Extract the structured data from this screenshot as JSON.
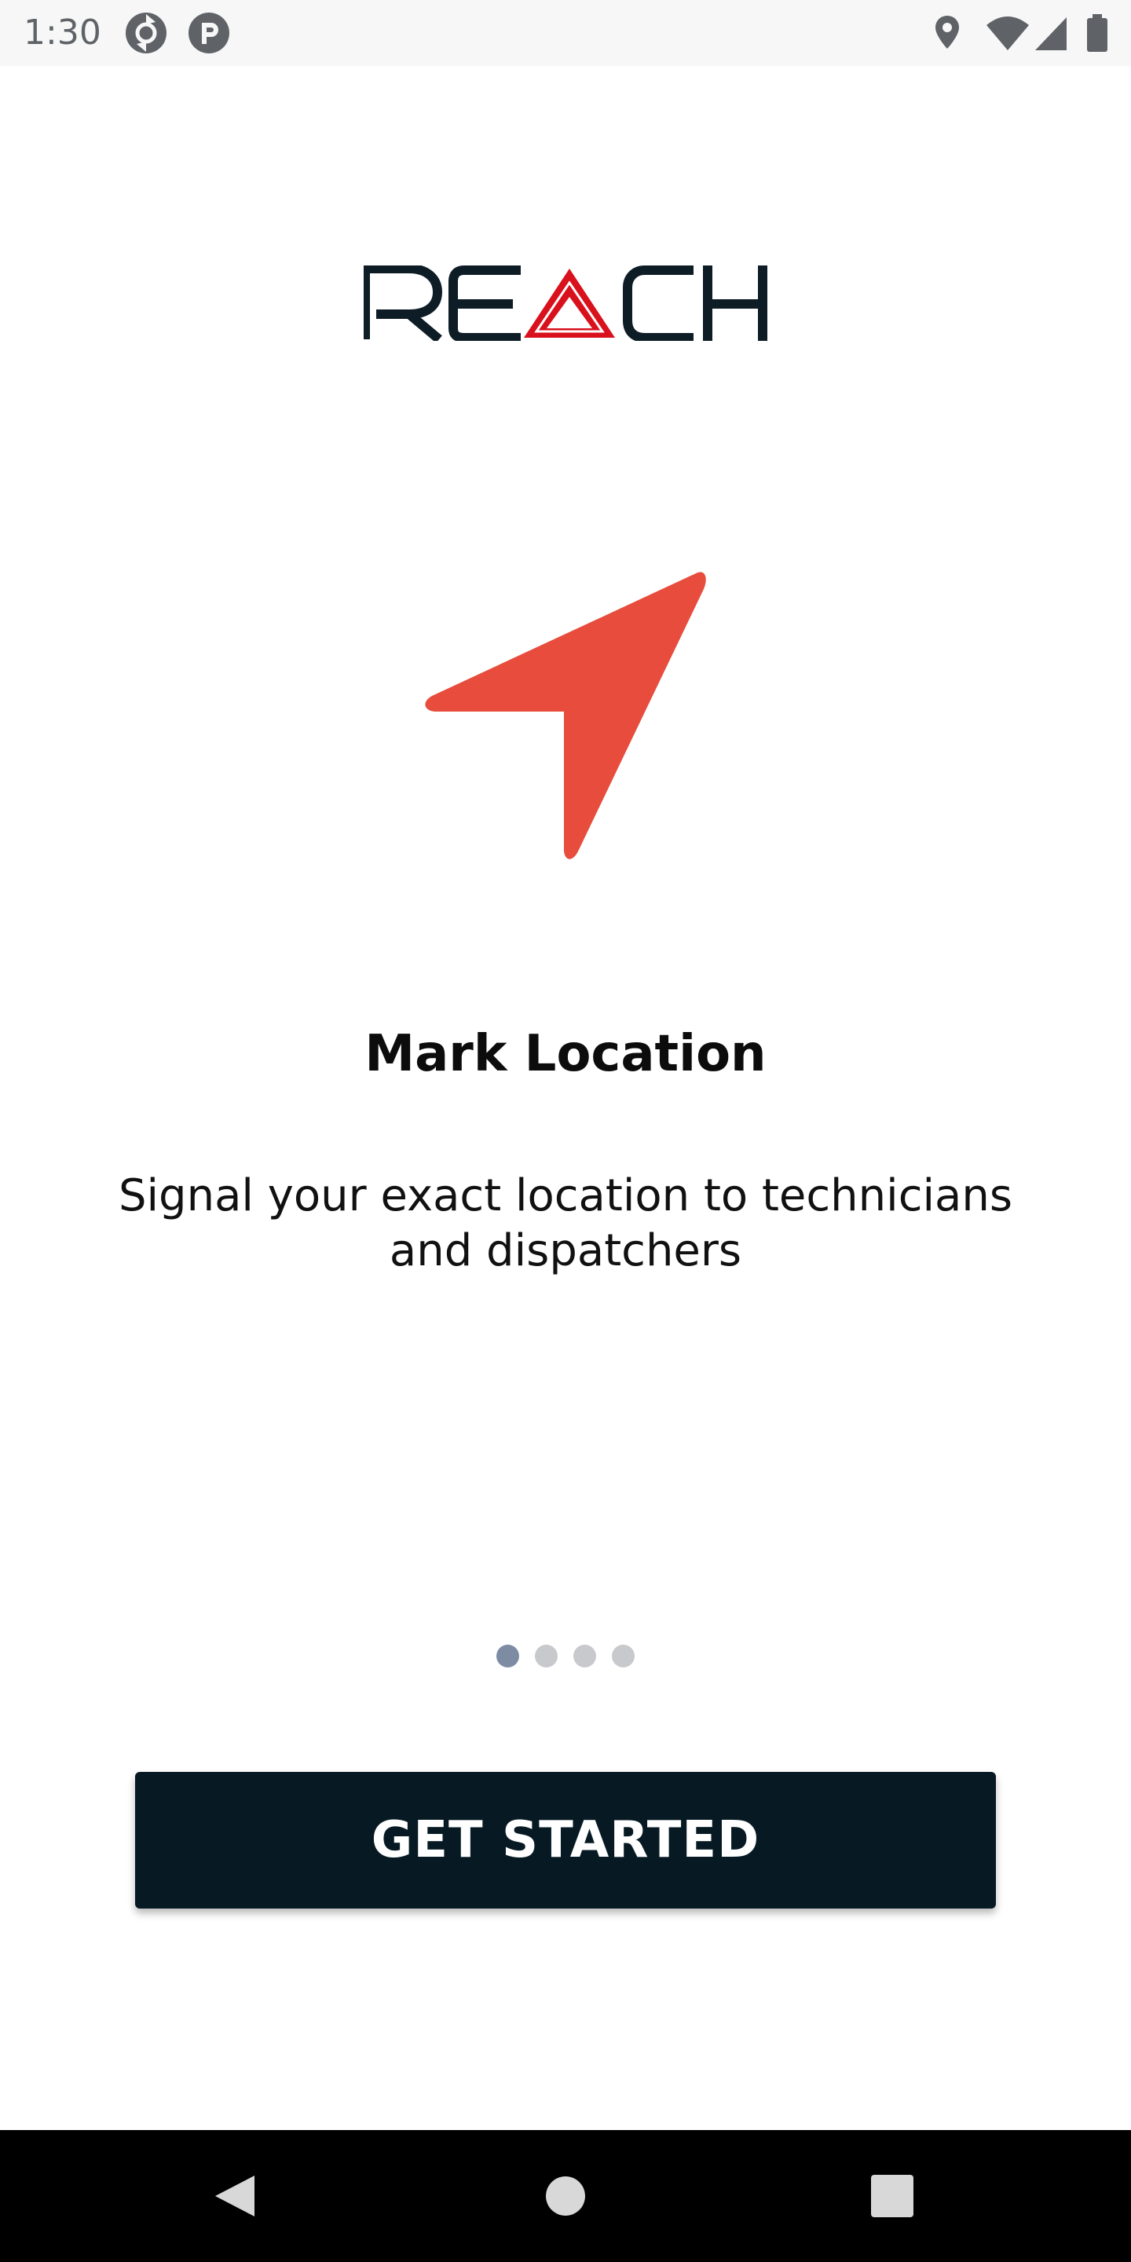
{
  "status_bar": {
    "time": "1:30",
    "left_icons": [
      "sync-app-icon",
      "r-app-icon"
    ],
    "right_icons": [
      "location-icon",
      "wifi-icon",
      "cell-signal-icon",
      "battery-icon"
    ]
  },
  "logo": {
    "text": "REACH",
    "colors": {
      "dark": "#0e1c26",
      "accent": "#d8111c"
    }
  },
  "slide": {
    "icon": "navigation-arrow-icon",
    "icon_color": "#e74c3c",
    "title": "Mark Location",
    "description": "Signal your exact location to technicians and dispatchers"
  },
  "pager": {
    "total": 4,
    "active_index": 0
  },
  "cta": {
    "label": "GET STARTED",
    "background": "#071a24"
  },
  "nav_bar": {
    "buttons": [
      "back-icon",
      "home-icon",
      "recents-icon"
    ]
  }
}
